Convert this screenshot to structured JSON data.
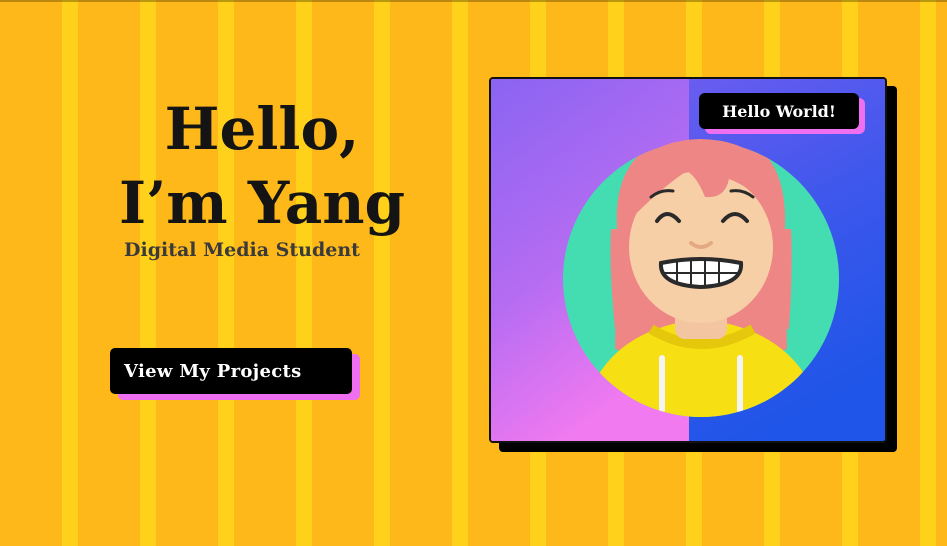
{
  "hero": {
    "greeting_line1": "Hello,",
    "greeting_line2": "I’m Yang",
    "subtitle": "Digital Media Student",
    "cta_label": "View My Projects"
  },
  "portrait": {
    "speech_bubble": "Hello World!",
    "avatar_icon": "smiling-girl-avatar-icon"
  },
  "colors": {
    "background": "#ffb81a",
    "stripe": "#ffd11a",
    "accent_pink": "#ee6ff0",
    "card_purple": "#8b5cf6",
    "card_blue": "#2557e8",
    "avatar_circle": "#44ddb2"
  }
}
